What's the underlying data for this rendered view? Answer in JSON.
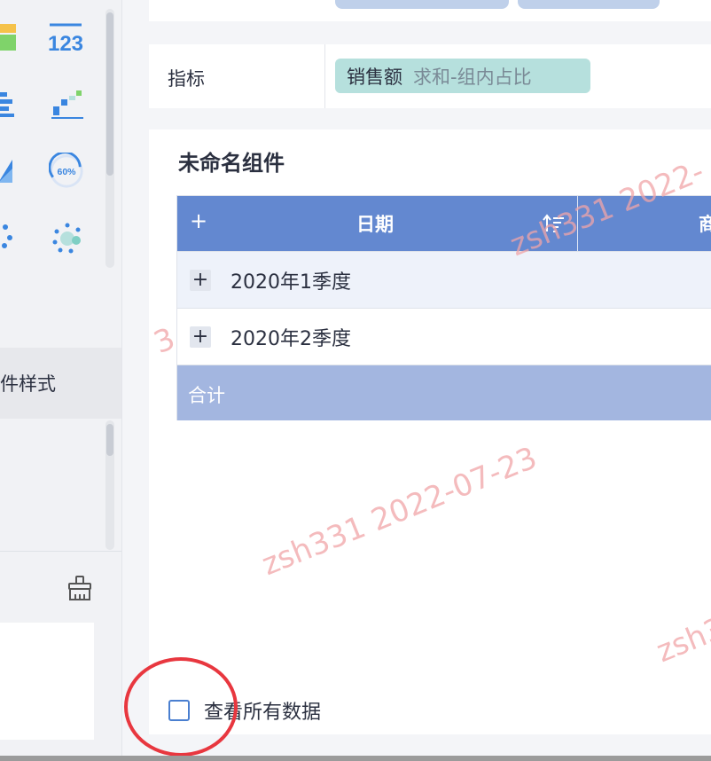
{
  "left_panel": {
    "tiles": [
      {
        "icon": "bar-chart-icon",
        "color": "#7fd36a"
      },
      {
        "icon": "number-card-icon",
        "text": "123",
        "color": "#3a86e0"
      },
      {
        "icon": "stacked-bar-icon",
        "color": "#3a86e0"
      },
      {
        "icon": "waterfall-chart-icon",
        "color": "#3a86e0"
      },
      {
        "icon": "area-chart-icon",
        "color": "#3a86e0"
      },
      {
        "icon": "gauge-icon",
        "text": "60%",
        "color": "#3a86e0"
      },
      {
        "icon": "scatter-icon",
        "color": "#3a86e0"
      },
      {
        "icon": "bubble-chart-icon",
        "color": "#3a86e0"
      }
    ],
    "style_tab_label": "组件样式",
    "style_tab_visible": "件样式"
  },
  "metric_row": {
    "label": "指标",
    "pill_name": "销售额",
    "pill_agg": "求和-组内占比"
  },
  "widget": {
    "title": "未命名组件",
    "table": {
      "header_plus": "+",
      "col_date": "日期",
      "col_2_partial": "商",
      "rows": [
        {
          "expand": "+",
          "value": "2020年1季度"
        },
        {
          "expand": "+",
          "value": "2020年2季度"
        }
      ],
      "total_label": "合计"
    }
  },
  "view_all_label": "查看所有数据",
  "watermark_text": "zsh331 2022-07-23",
  "watermark_fragments": [
    "zsh331 2022-",
    "3",
    "zsh3"
  ],
  "colors": {
    "header_blue": "#6388d0",
    "total_blue": "#a3b6e0",
    "pill_teal": "#b6e0dd",
    "annotation_red": "#e8373f"
  }
}
